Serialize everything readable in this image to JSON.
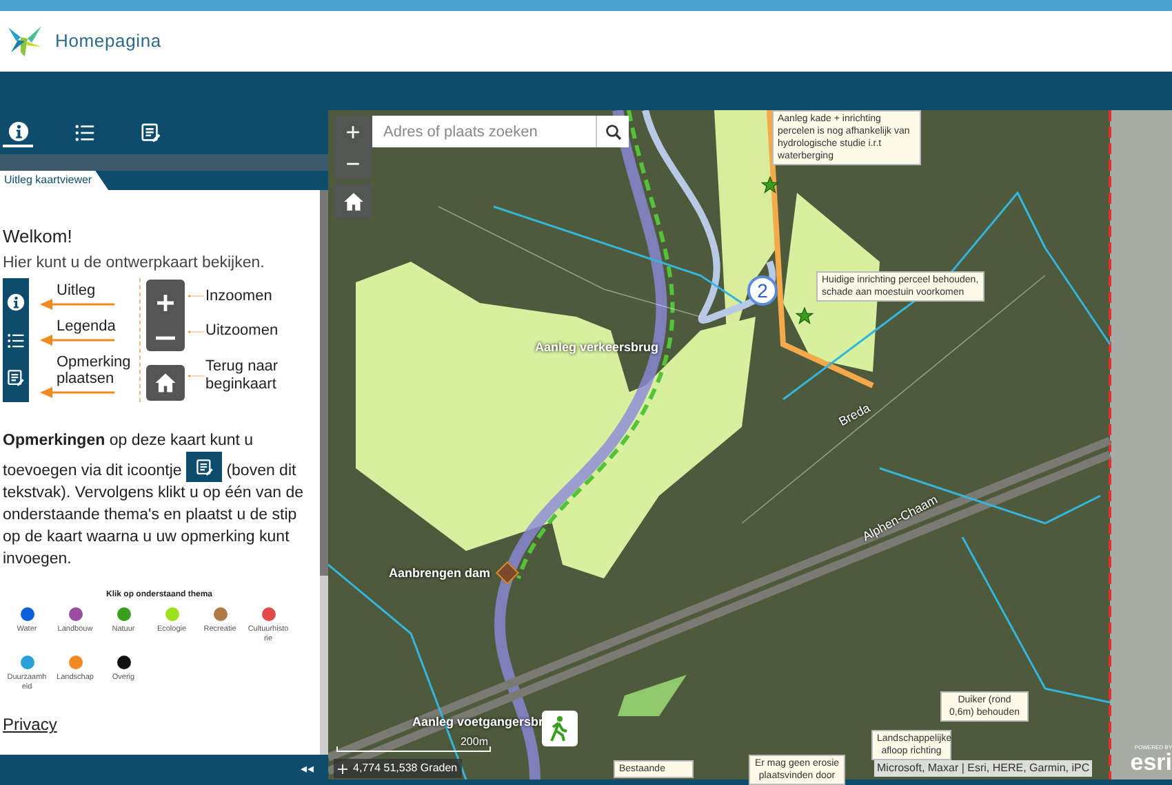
{
  "header": {
    "title": "Homepagina"
  },
  "panel": {
    "toolbar": [
      {
        "kind": "info",
        "selected": true
      },
      {
        "kind": "list",
        "selected": false
      },
      {
        "kind": "note",
        "selected": false
      }
    ],
    "tab": "Uitleg kaartviewer",
    "welcome": "Welkom!",
    "intro": "Hier kunt u de ontwerpkaart bekijken.",
    "guide_left": [
      {
        "kind": "info",
        "label": "Uitleg"
      },
      {
        "kind": "list",
        "label": "Legenda"
      },
      {
        "kind": "note",
        "label": "Opmerking plaatsen"
      }
    ],
    "guide_right": [
      {
        "kind": "plus",
        "label": "Inzoomen"
      },
      {
        "kind": "minus",
        "label": "Uitzoomen"
      },
      {
        "kind": "home",
        "label": "Terug naar beginkaart"
      }
    ],
    "remarks_before": "**Opmerkingen** op deze kaart kunt u toevoegen via dit icoontje",
    "remarks_after": "(boven dit tekstvak). Vervolgens klikt u op één van de onderstaande thema's en plaatst u de stip op de kaart waarna u uw opmerking kunt invoegen.",
    "theme_heading": "Klik op onderstaand thema",
    "themes": [
      {
        "label": "Water",
        "color": "#0b5fd8"
      },
      {
        "label": "Landbouw",
        "color": "#9b4ea0"
      },
      {
        "label": "Natuur",
        "color": "#3a9e1f"
      },
      {
        "label": "Ecologie",
        "color": "#9be21b"
      },
      {
        "label": "Recreatie",
        "color": "#b07a46"
      },
      {
        "label": "Cultuurhistorie",
        "color": "#e24a4a"
      },
      {
        "label": "Duurzaamheid",
        "color": "#2aa0d8"
      },
      {
        "label": "Landschap",
        "color": "#f08a22"
      },
      {
        "label": "Overig",
        "color": "#111111"
      }
    ],
    "privacy": "Privacy",
    "collapse": "◂◂"
  },
  "map": {
    "search": {
      "placeholder": "Adres of plaats zoeken"
    },
    "zoom_in": "+",
    "zoom_out": "−",
    "notes": [
      {
        "text": "Aanleg kade + inrichting percelen is nog afhankelijk van hydrologische studie i.r.t waterberging"
      },
      {
        "text": "Huidige inrichting perceel behouden, schade aan moestuin voorkomen"
      },
      {
        "text": "Duiker (rond 0,6m) behouden"
      },
      {
        "text": "Landschappelijke afloop richting"
      },
      {
        "text": "Bestaande"
      },
      {
        "text": "Er mag geen erosie plaatsvinden door"
      }
    ],
    "marker_number": "2",
    "labels": [
      "Aanleg verkeersbrug",
      "Aanbrengen dam",
      "Aanleg voetgangersbr"
    ],
    "roads": [
      "Breda",
      "Alphen-Chaam"
    ],
    "scale": "200m",
    "coordinates": "4,774 51,538 Graden",
    "attribution": "Microsoft, Maxar | Esri, HERE, Garmin, iPC",
    "powered_by": "POWERED BY",
    "logo": "esri"
  }
}
